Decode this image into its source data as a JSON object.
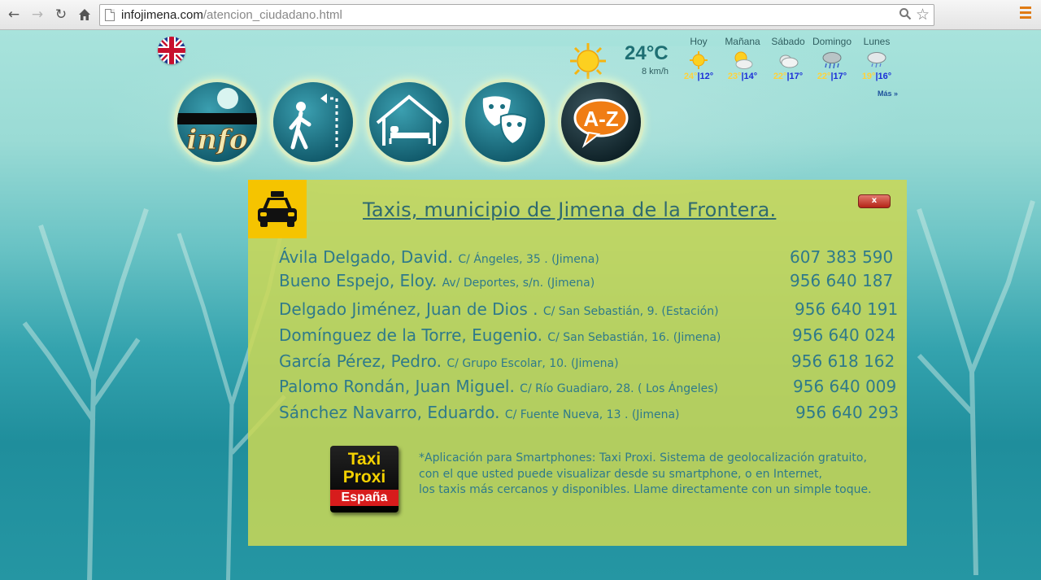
{
  "browser": {
    "url_host": "infojimena.com",
    "url_path": "/atencion_ciudadano.html"
  },
  "weather": {
    "current_temp": "24°C",
    "wind": "8 km/h",
    "more_label": "Más »",
    "forecast": [
      {
        "day": "Hoy",
        "high": "24°",
        "low": "12°",
        "icon": "sun-icon"
      },
      {
        "day": "Mañana",
        "high": "23°",
        "low": "14°",
        "icon": "sun-cloud-icon"
      },
      {
        "day": "Sábado",
        "high": "22°",
        "low": "17°",
        "icon": "cloud-icon"
      },
      {
        "day": "Domingo",
        "high": "22°",
        "low": "17°",
        "icon": "rain-icon"
      },
      {
        "day": "Lunes",
        "high": "19°",
        "low": "16°",
        "icon": "showers-icon"
      }
    ]
  },
  "nav": {
    "buttons": [
      {
        "label": "info",
        "icon": "info-icon"
      },
      {
        "label": "",
        "icon": "hiking-icon"
      },
      {
        "label": "",
        "icon": "lodging-icon"
      },
      {
        "label": "",
        "icon": "theatre-masks-icon"
      },
      {
        "label": "A-Z",
        "icon": "a-z-icon"
      }
    ]
  },
  "panel": {
    "title": "Taxis, municipio de Jimena de la Frontera.",
    "close_label": "x",
    "taxis": [
      {
        "name": "Ávila Delgado, David.",
        "address": "C/ Ángeles, 35 . (Jimena)",
        "phone": "607 383 590"
      },
      {
        "name": "Bueno Espejo, Eloy.",
        "address": "Av/ Deportes, s/n. (Jimena)",
        "phone": "956 640 187"
      },
      {
        "name": "Delgado Jiménez, Juan de Dios .",
        "address": "C/ San Sebastián, 9. (Estación)",
        "phone": "956 640 191"
      },
      {
        "name": "Domínguez de la Torre, Eugenio.",
        "address": "C/ San Sebastián, 16. (Jimena)",
        "phone": "956 640 024"
      },
      {
        "name": "García Pérez, Pedro.",
        "address": "C/ Grupo Escolar, 10.  (Jimena)",
        "phone": "956 618 162"
      },
      {
        "name": "Palomo Rondán, Juan Miguel.",
        "address": "C/ Río Guadiaro, 28. ( Los Ángeles)",
        "phone": "956 640 009"
      },
      {
        "name": "Sánchez Navarro, Eduardo.",
        "address": "C/ Fuente Nueva, 13 . (Jimena)",
        "phone": "956 640 293"
      }
    ],
    "app_logo": {
      "line1": "Taxi",
      "line2": "Proxi",
      "line3": "España"
    },
    "app_text": [
      " *Aplicación para Smartphones: Taxi Proxi. Sistema de geolocalización gratuito,",
      "con el que usted puede visualizar desde su smartphone, o en Internet,",
      "los taxis más cercanos y disponibles. Llame directamente con un simple toque."
    ]
  },
  "colors": {
    "panel_bg": "#cbd755",
    "text_teal": "#2f7a8a",
    "taxi_badge": "#f5c400",
    "temp_high": "#ffd23a",
    "temp_low": "#1b2fd8"
  }
}
